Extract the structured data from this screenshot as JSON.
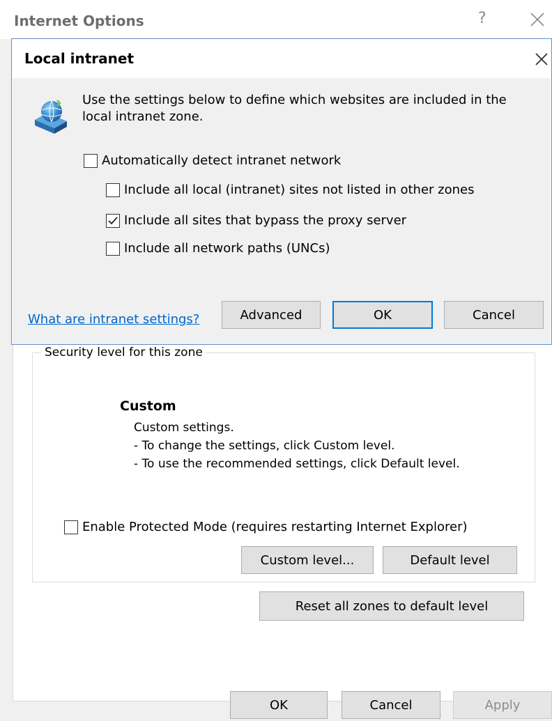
{
  "parent_window": {
    "title": "Internet Options",
    "help_glyph": "?",
    "security_group": {
      "legend": "Security level for this zone",
      "level_title": "Custom",
      "description": [
        "Custom settings.",
        "- To change the settings, click Custom level.",
        "- To use the recommended settings, click Default level."
      ]
    },
    "protected_mode": {
      "label": "Enable Protected Mode (requires restarting Internet Explorer)",
      "checked": false
    },
    "buttons": {
      "custom_level": "Custom level...",
      "default_level": "Default level",
      "reset_all": "Reset all zones to default level",
      "ok": "OK",
      "cancel": "Cancel",
      "apply": "Apply"
    }
  },
  "dialog": {
    "title": "Local intranet",
    "intro_text": "Use the settings below to define which websites are included in the local intranet zone.",
    "options": [
      {
        "label": "Automatically detect intranet network",
        "checked": false
      },
      {
        "label": "Include all local (intranet) sites not listed in other zones",
        "checked": false
      },
      {
        "label": "Include all sites that bypass the proxy server",
        "checked": true
      },
      {
        "label": "Include all network paths (UNCs)",
        "checked": false
      }
    ],
    "help_link": "What are intranet settings?",
    "buttons": {
      "advanced": "Advanced",
      "ok": "OK",
      "cancel": "Cancel"
    }
  },
  "icons": [
    "close-icon",
    "help-icon",
    "network-globe-icon",
    "checkmark-icon"
  ],
  "colors": {
    "accent": "#0078d7",
    "link": "#0066cc",
    "dialog_border": "#5e8fc7"
  }
}
